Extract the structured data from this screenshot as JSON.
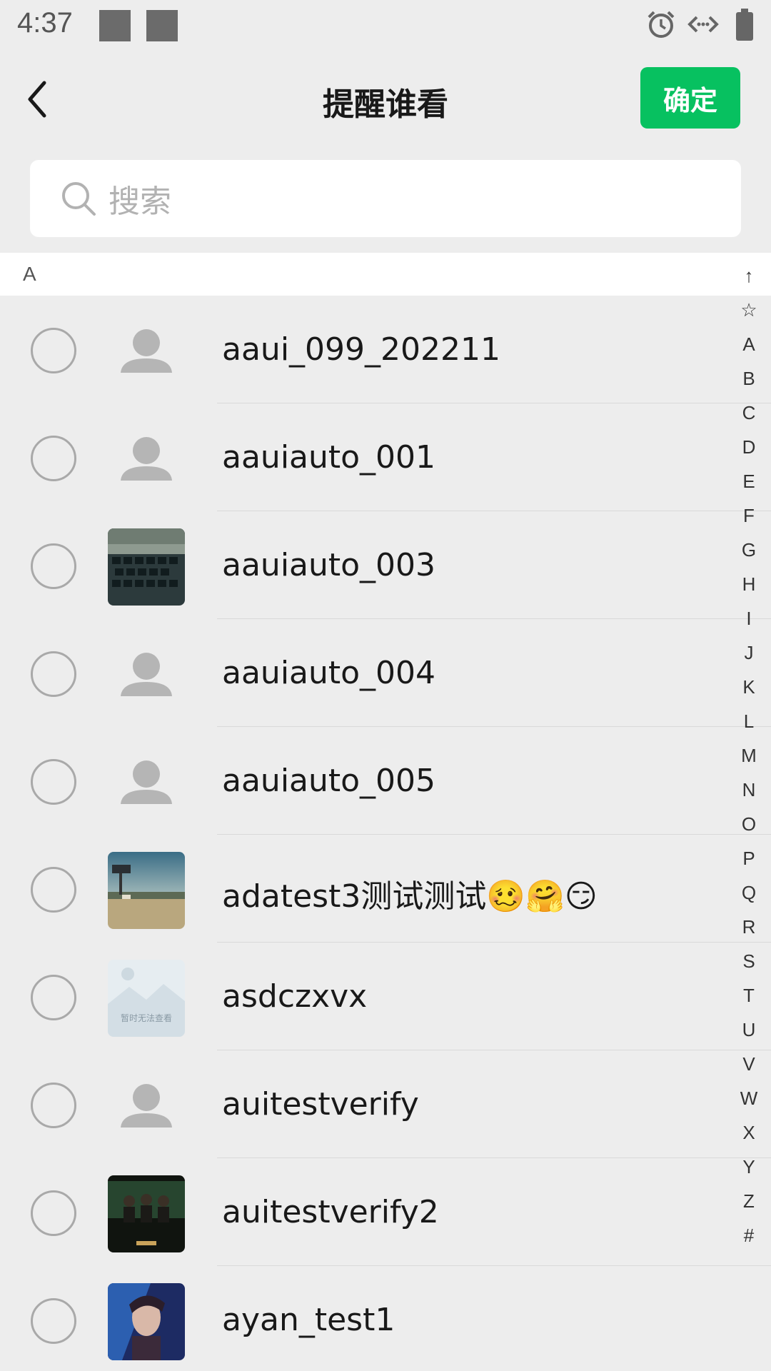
{
  "status_bar": {
    "time": "4:37"
  },
  "nav": {
    "title": "提醒谁看",
    "confirm_label": "确定"
  },
  "search": {
    "placeholder": "搜索"
  },
  "section": {
    "letter": "A"
  },
  "contacts": [
    {
      "name": "aaui_099_202211",
      "avatar": "default-person-avatar"
    },
    {
      "name": "aauiauto_001",
      "avatar": "default-person-avatar"
    },
    {
      "name": "aauiauto_003",
      "avatar": "photo-keyboard-avatar"
    },
    {
      "name": "aauiauto_004",
      "avatar": "default-person-avatar"
    },
    {
      "name": "aauiauto_005",
      "avatar": "default-person-avatar"
    },
    {
      "name": "adatest3测试测试🥴🤗😏",
      "avatar": "photo-landscape-avatar"
    },
    {
      "name": "asdczxvx",
      "avatar": "image-placeholder-avatar",
      "avatar_caption": "暂时无法查看"
    },
    {
      "name": "auitestverify",
      "avatar": "default-person-avatar"
    },
    {
      "name": "auitestverify2",
      "avatar": "photo-group-avatar"
    },
    {
      "name": "ayan_test1",
      "avatar": "photo-portrait-avatar"
    }
  ],
  "index_bar": [
    "↑",
    "☆",
    "A",
    "B",
    "C",
    "D",
    "E",
    "F",
    "G",
    "H",
    "I",
    "J",
    "K",
    "L",
    "M",
    "N",
    "O",
    "P",
    "Q",
    "R",
    "S",
    "T",
    "U",
    "V",
    "W",
    "X",
    "Y",
    "Z",
    "#"
  ],
  "colors": {
    "accent": "#07c160",
    "background": "#ededed",
    "radio_border": "#a9a9a9"
  }
}
